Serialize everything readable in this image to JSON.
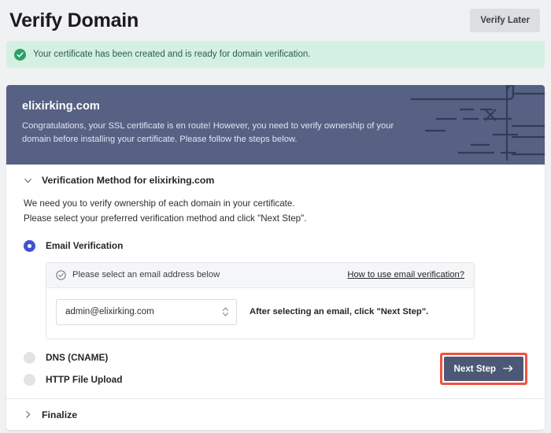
{
  "header": {
    "title": "Verify Domain",
    "verify_later_label": "Verify Later"
  },
  "banner": {
    "icon": "check-circle-icon",
    "text": "Your certificate has been created and is ready for domain verification.",
    "background_color": "#d4f0e2",
    "icon_color": "#2aa06a"
  },
  "hero": {
    "domain": "elixirking.com",
    "description": "Congratulations, your SSL certificate is en route! However, you need to verify ownership of your domain before installing your certificate. Please follow the steps below.",
    "background_color": "#566184"
  },
  "verification_section": {
    "chevron": "chevron-down-icon",
    "title": "Verification Method for elixirking.com",
    "intro_line_1": "We need you to verify ownership of each domain in your certificate.",
    "intro_line_2": "Please select your preferred verification method and click \"Next Step\".",
    "options": [
      {
        "label": "Email Verification",
        "selected": true
      },
      {
        "label": "DNS (CNAME)",
        "selected": false
      },
      {
        "label": "HTTP File Upload",
        "selected": false
      }
    ],
    "email_panel": {
      "icon": "check-ring-icon",
      "heading": "Please select an email address below",
      "help_link": "How to use email verification?",
      "select": {
        "value": "admin@elixirking.com",
        "icon": "stepper-updown-icon"
      },
      "hint": "After selecting an email, click \"Next Step\"."
    },
    "next_button": {
      "label": "Next Step",
      "icon": "arrow-right-icon",
      "background_color": "#4c5875",
      "highlight_color": "#f0523f"
    }
  },
  "finalize_section": {
    "chevron": "chevron-right-icon",
    "title": "Finalize"
  }
}
